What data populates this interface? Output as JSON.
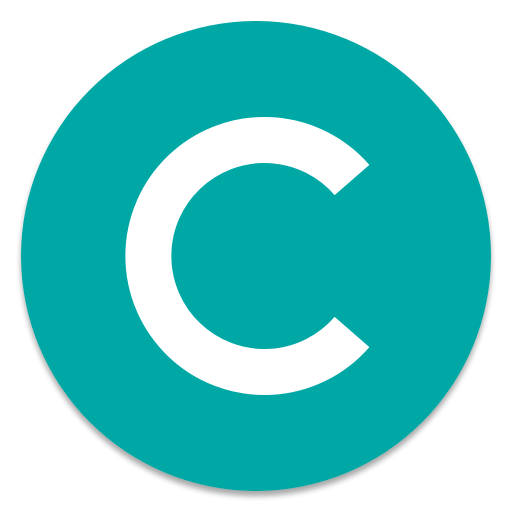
{
  "app_icon": {
    "icon_name": "letter-c-logo-icon",
    "letter": "C",
    "colors": {
      "circle": "#00a8a5",
      "letter": "#ffffff",
      "background": "#ffffff",
      "shadow": "#00000033"
    }
  }
}
